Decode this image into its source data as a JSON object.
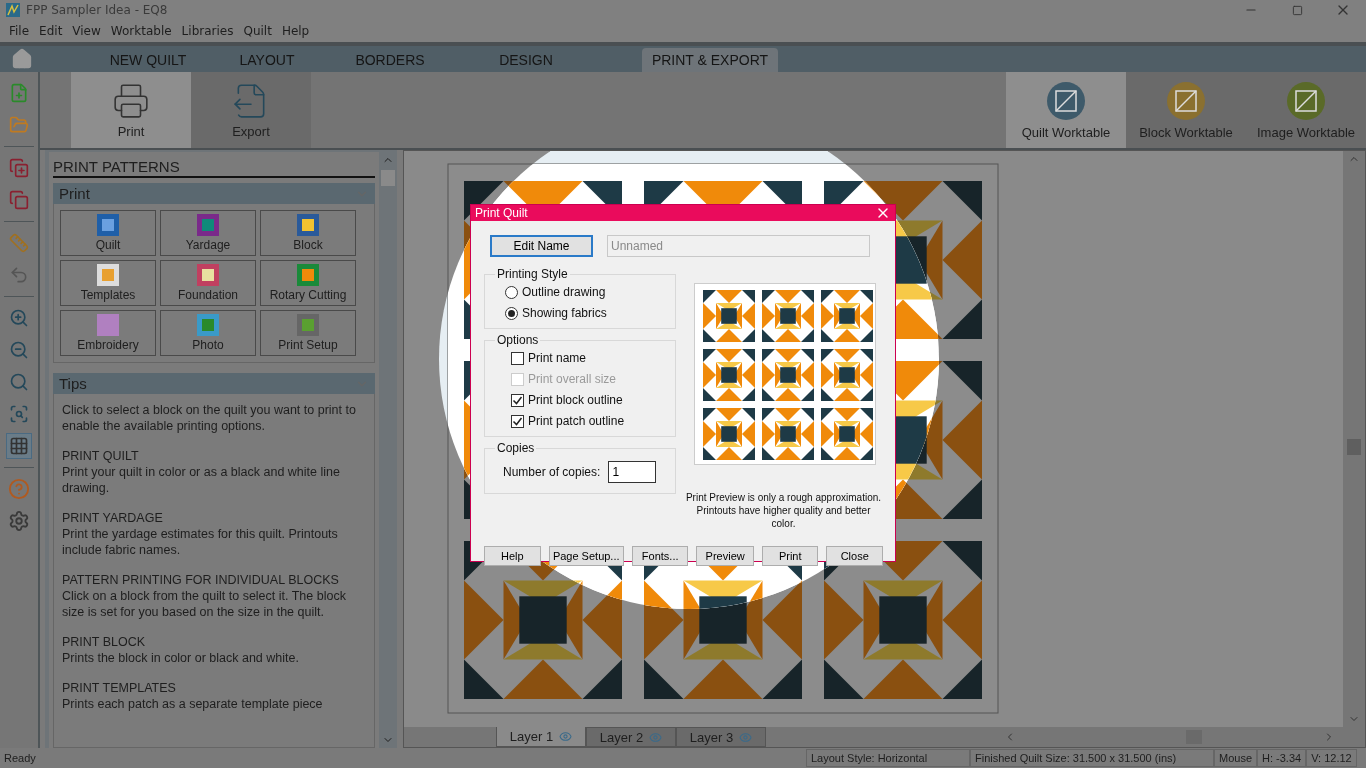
{
  "window": {
    "title": "FPP Sampler Idea - EQ8"
  },
  "menu": [
    "File",
    "Edit",
    "View",
    "Worktable",
    "Libraries",
    "Quilt",
    "Help"
  ],
  "tabs": [
    {
      "label": "NEW QUILT",
      "selected": false
    },
    {
      "label": "LAYOUT",
      "selected": false
    },
    {
      "label": "BORDERS",
      "selected": false
    },
    {
      "label": "DESIGN",
      "selected": false
    },
    {
      "label": "PRINT & EXPORT",
      "selected": true
    }
  ],
  "ribbon": {
    "tools": [
      {
        "label": "Print",
        "selected": true
      },
      {
        "label": "Export",
        "selected": false
      }
    ],
    "worktables": [
      {
        "label": "Quilt Worktable",
        "selected": true
      },
      {
        "label": "Block Worktable",
        "selected": false
      },
      {
        "label": "Image Worktable",
        "selected": false
      }
    ]
  },
  "panel": {
    "title": "PRINT PATTERNS",
    "print_header": "Print",
    "print_buttons": [
      "Quilt",
      "Yardage",
      "Block",
      "Templates",
      "Foundation",
      "Rotary Cutting",
      "Embroidery",
      "Photo",
      "Print Setup"
    ],
    "tips_header": "Tips",
    "tips": [
      {
        "text": "Click to select a block on the quilt you want to print to enable the available printing options."
      },
      {
        "heading": "PRINT QUILT",
        "text": "Print your quilt in color or as a black and white line drawing."
      },
      {
        "heading": "PRINT YARDAGE",
        "text": "Print the yardage estimates for this quilt. Printouts include fabric names."
      },
      {
        "heading": "PATTERN PRINTING FOR INDIVIDUAL BLOCKS",
        "text": "Click on a block from the quilt to select it. The block size is set for you based on the size in the quilt."
      },
      {
        "heading": "PRINT BLOCK",
        "text": "Prints the block in color or black and white."
      },
      {
        "heading": "PRINT TEMPLATES",
        "text": "Prints each patch as a separate template piece"
      }
    ]
  },
  "layers": [
    {
      "label": "Layer 1",
      "selected": true
    },
    {
      "label": "Layer 2",
      "selected": false
    },
    {
      "label": "Layer 3",
      "selected": false
    }
  ],
  "dialog": {
    "title": "Print Quilt",
    "edit_name_button": "Edit Name",
    "name_field": {
      "value": "Unnamed",
      "disabled": true
    },
    "printing_style": {
      "legend": "Printing Style",
      "options": [
        {
          "label": "Outline drawing",
          "selected": false
        },
        {
          "label": "Showing fabrics",
          "selected": true
        }
      ]
    },
    "options": {
      "legend": "Options",
      "checkboxes": [
        {
          "label": "Print name",
          "checked": false,
          "disabled": false
        },
        {
          "label": "Print overall size",
          "checked": false,
          "disabled": true
        },
        {
          "label": "Print block outline",
          "checked": true,
          "disabled": false
        },
        {
          "label": "Print patch outline",
          "checked": true,
          "disabled": false
        }
      ]
    },
    "copies": {
      "legend": "Copies",
      "label": "Number of copies:",
      "value": "1"
    },
    "preview_note": [
      "Print Preview is only a rough approximation.",
      "Printouts have higher quality and better color."
    ],
    "buttons": [
      "Help",
      "Page Setup...",
      "Fonts...",
      "Preview",
      "Print",
      "Close"
    ]
  },
  "status_bar": {
    "ready": "Ready",
    "layout_style": "Layout Style: Horizontal",
    "finished_size": "Finished Quilt Size: 31.500 x 31.500 (ins)",
    "mouse": {
      "label": "Mouse",
      "h": "H:  -3.34",
      "v": "V:  12.12"
    }
  }
}
